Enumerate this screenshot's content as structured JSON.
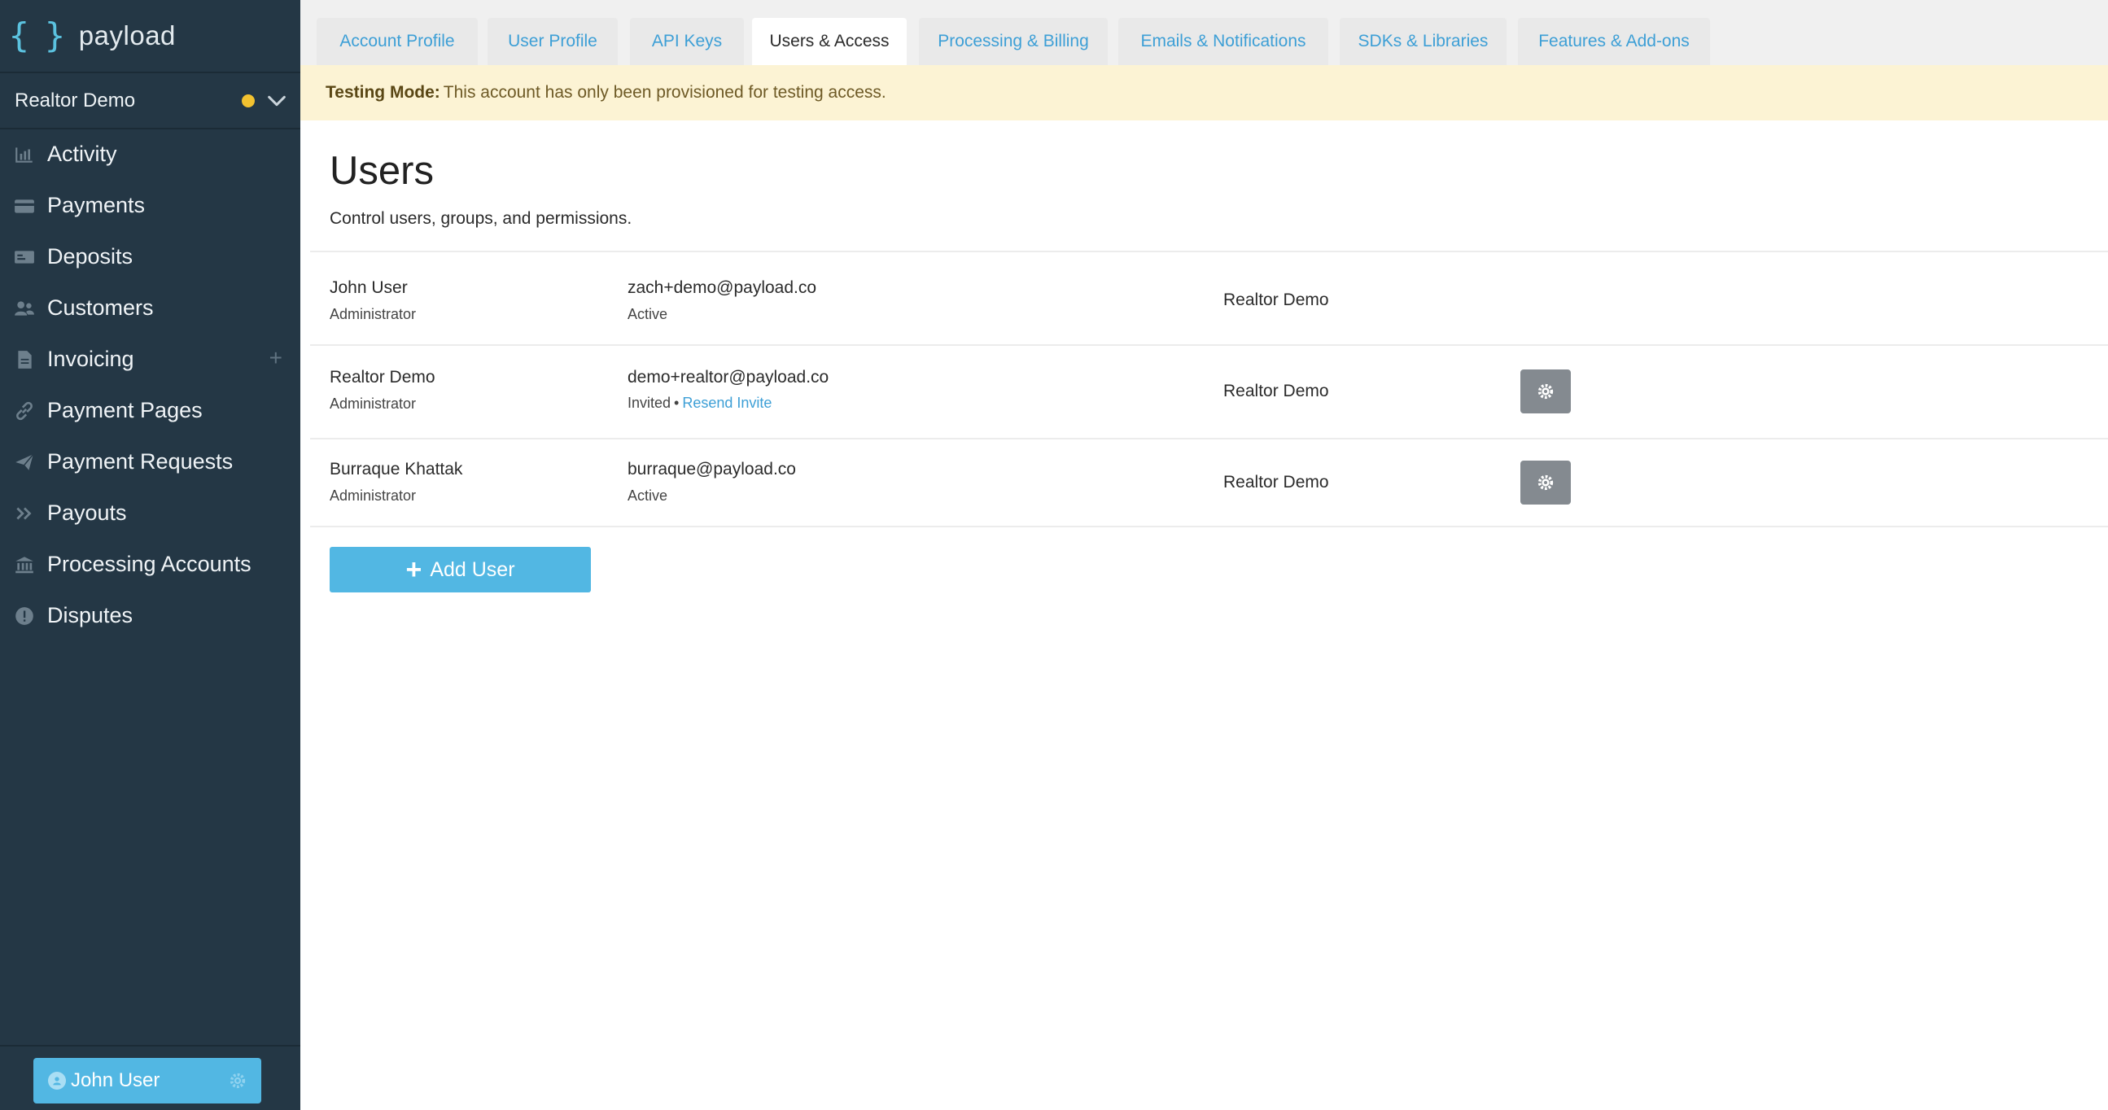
{
  "brand": {
    "mark": "{ }",
    "name": "payload"
  },
  "account": {
    "name": "Realtor Demo",
    "status_color": "#f2c230"
  },
  "nav": [
    {
      "label": "Activity",
      "icon": "bar-chart-icon"
    },
    {
      "label": "Payments",
      "icon": "credit-card-icon"
    },
    {
      "label": "Deposits",
      "icon": "bank-note-icon"
    },
    {
      "label": "Customers",
      "icon": "users-icon"
    },
    {
      "label": "Invoicing",
      "icon": "document-icon",
      "action": "+"
    },
    {
      "label": "Payment Pages",
      "icon": "link-icon"
    },
    {
      "label": "Payment Requests",
      "icon": "paper-plane-icon"
    },
    {
      "label": "Payouts",
      "icon": "double-chevron-right-icon"
    },
    {
      "label": "Processing Accounts",
      "icon": "bank-building-icon"
    },
    {
      "label": "Disputes",
      "icon": "alert-circle-icon"
    }
  ],
  "current_user": {
    "name": "John User"
  },
  "tabs": [
    {
      "label": "Account Profile",
      "active": false
    },
    {
      "label": "User Profile",
      "active": false
    },
    {
      "label": "API Keys",
      "active": false
    },
    {
      "label": "Users & Access",
      "active": true
    },
    {
      "label": "Processing & Billing",
      "active": false
    },
    {
      "label": "Emails & Notifications",
      "active": false
    },
    {
      "label": "SDKs & Libraries",
      "active": false
    },
    {
      "label": "Features & Add-ons",
      "active": false
    }
  ],
  "banner": {
    "strong": "Testing Mode:",
    "text": "This account has only been provisioned for testing access.",
    "bg": "#fcf3d4"
  },
  "page": {
    "title": "Users",
    "subtitle": "Control users, groups, and permissions."
  },
  "users": [
    {
      "name": "John User",
      "role": "Administrator",
      "email": "zach+demo@payload.co",
      "status": "Active",
      "account": "Realtor Demo"
    },
    {
      "name": "Realtor Demo",
      "role": "Administrator",
      "email": "demo+realtor@payload.co",
      "status": "Invited",
      "status_separator": "•",
      "resend_label": "Resend Invite",
      "account": "Realtor Demo"
    },
    {
      "name": "Burraque Khattak",
      "role": "Administrator",
      "email": "burraque@payload.co",
      "status": "Active",
      "account": "Realtor Demo"
    }
  ],
  "add_user": {
    "plus": "+",
    "label": "Add User"
  },
  "colors": {
    "sidebar": "#243745",
    "accent": "#52b7e3",
    "link": "#3d9fd6",
    "gear_button": "#848a90"
  }
}
